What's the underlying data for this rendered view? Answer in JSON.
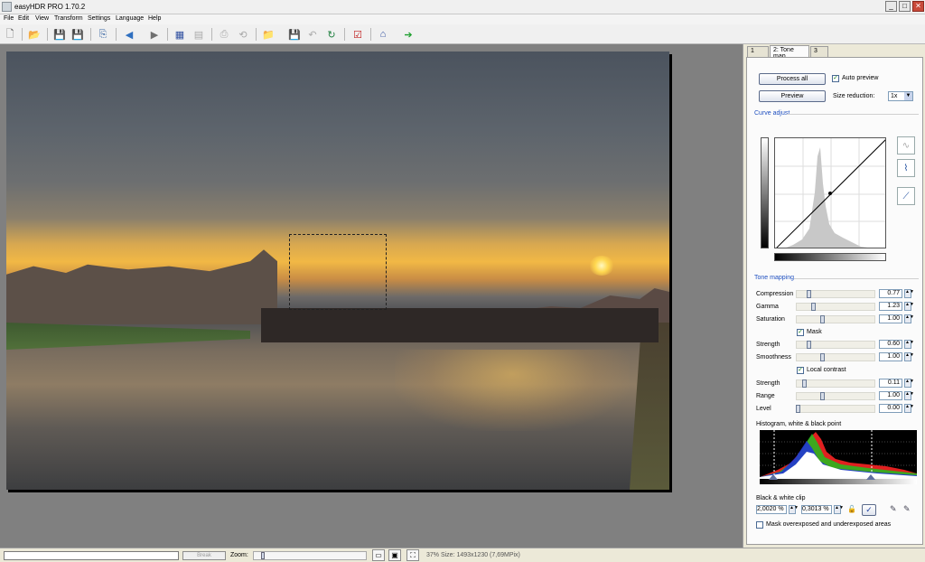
{
  "window": {
    "title": "easyHDR PRO 1.70.2",
    "minimize": "_",
    "maximize": "□",
    "close": "✕"
  },
  "menu": [
    "File",
    "Edit",
    "View",
    "Transform",
    "Settings",
    "Language",
    "Help"
  ],
  "toolbar": [
    {
      "name": "new-document-icon",
      "glyph": "🗋"
    },
    {
      "name": "open-folder-icon",
      "glyph": "📂"
    },
    {
      "name": "save-icon",
      "glyph": "💾"
    },
    {
      "name": "save-as-icon",
      "glyph": "💾"
    },
    {
      "name": "copy-icon",
      "glyph": "⎘"
    },
    {
      "name": "previous-icon",
      "glyph": "◀"
    },
    {
      "name": "next-icon",
      "glyph": "▶"
    },
    {
      "name": "compare-icon",
      "glyph": "▦"
    },
    {
      "name": "image-list-icon",
      "glyph": "▤"
    },
    {
      "name": "page-icon",
      "glyph": "⎙"
    },
    {
      "name": "undo-circle-icon",
      "glyph": "⟲"
    },
    {
      "name": "batch-open-icon",
      "glyph": "📁"
    },
    {
      "name": "batch-save-icon",
      "glyph": "💾"
    },
    {
      "name": "undo-icon",
      "glyph": "↶"
    },
    {
      "name": "redo-icon",
      "glyph": "↻"
    },
    {
      "name": "checklist-icon",
      "glyph": "☑"
    },
    {
      "name": "home-icon",
      "glyph": "⌂"
    },
    {
      "name": "go-icon",
      "glyph": "➔"
    }
  ],
  "tabs": [
    "1",
    "2: Tone map",
    "3"
  ],
  "panel": {
    "process_all": "Process all",
    "auto_preview": "Auto preview",
    "preview": "Preview",
    "size_reduction_label": "Size reduction:",
    "size_reduction_value": "1x",
    "curve_adjust_title": "Curve adjust",
    "tone_mapping_title": "Tone mapping",
    "sliders": [
      {
        "label": "Compression",
        "value": "0.77",
        "level": 0.14
      },
      {
        "label": "Gamma",
        "value": "1.23",
        "level": 0.2
      },
      {
        "label": "Saturation",
        "value": "1.00",
        "level": 0.33
      }
    ],
    "mask_label": "Mask",
    "mask_sliders": [
      {
        "label": "Strength",
        "value": "0.60",
        "level": 0.14
      },
      {
        "label": "Smoothness",
        "value": "1.00",
        "level": 0.33
      }
    ],
    "local_contrast_label": "Local contrast",
    "local_sliders": [
      {
        "label": "Strength",
        "value": "0.11",
        "level": 0.08
      },
      {
        "label": "Range",
        "value": "1.00",
        "level": 0.33
      },
      {
        "label": "Level",
        "value": "0.00",
        "level": 0.0
      }
    ],
    "histogram_title": "Histogram, white & black point",
    "bw_clip_title": "Black & white clip",
    "black_clip": "2,0020 %",
    "white_clip": "0,3013 %",
    "mask_exposed_label": "Mask overexposed and underexposed areas"
  },
  "statusbar": {
    "break": "Break",
    "zoom_label": "Zoom:",
    "info": "37%  Size: 1493x1230 (7,69MPix)"
  }
}
